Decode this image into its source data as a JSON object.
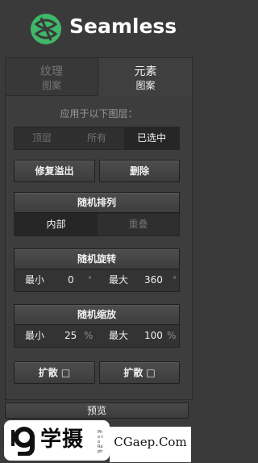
{
  "app": {
    "logo_text": "Seamless",
    "logo_color": "#3fb869"
  },
  "tabs": [
    {
      "line1": "纹理",
      "line2": "图案",
      "active": false
    },
    {
      "line1": "元素",
      "line2": "图案",
      "active": true
    }
  ],
  "apply_to": {
    "label": "应用于以下图层：",
    "options": [
      "顶层",
      "所有",
      "已选中"
    ],
    "selected": "已选中"
  },
  "actions": {
    "fix_overflow": "修复溢出",
    "delete": "删除"
  },
  "random_arrange": {
    "header": "随机排列",
    "options": [
      "内部",
      "重叠"
    ],
    "selected": "内部"
  },
  "random_rotate": {
    "header": "随机旋转",
    "min_label": "最小",
    "min_value": "0",
    "max_label": "最大",
    "max_value": "360",
    "unit": "°"
  },
  "random_scale": {
    "header": "随机缩放",
    "min_label": "最小",
    "min_value": "25",
    "max_label": "最大",
    "max_value": "100",
    "unit": "%"
  },
  "spread": {
    "left": "扩散 □",
    "right": "扩散 □"
  },
  "preview": "预览",
  "watermark": {
    "left_text": "学摄",
    "left_small": "Pho to Ra ph",
    "right_text": "CGaep.Com"
  }
}
